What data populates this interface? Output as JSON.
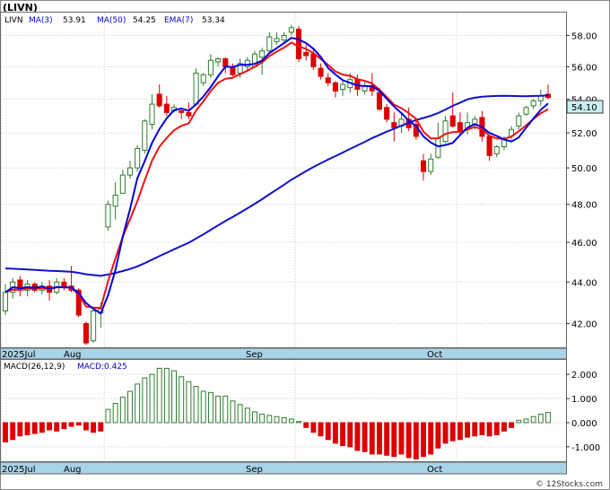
{
  "title": "(LIVN)",
  "price_panel": {
    "ticker": "LIVN",
    "indicators": [
      {
        "label": "MA(3)",
        "value": "53.91",
        "color": "#0000cc"
      },
      {
        "label": "MA(50)",
        "value": "54.25",
        "color": "#0000cc"
      },
      {
        "label": "EMA(7)",
        "value": "53.34",
        "color": "#0000cc"
      }
    ],
    "last_price": "54.10",
    "y_ticks": [
      "58.00",
      "56.00",
      "54.00",
      "52.00",
      "50.00",
      "48.00",
      "46.00",
      "44.00",
      "42.00"
    ],
    "x_labels": [
      "2025Jul",
      "Aug",
      "Sep",
      "Oct"
    ]
  },
  "macd_panel": {
    "label": "MACD(26,12,9)",
    "value_label": "MACD:0.425",
    "y_ticks": [
      "2.000",
      "1.000",
      "0.000",
      "-1.000"
    ],
    "x_labels": [
      "2025Jul",
      "Aug",
      "Sep",
      "Oct"
    ]
  },
  "footer": "© 12Stocks.com",
  "colors": {
    "up": "#2e7d2e",
    "down": "#dd0000",
    "ma_fast": "#0000dd",
    "ma_slow": "#1111cc",
    "ema": "#ee1111",
    "axis_bar": "#a9d3e8",
    "label_box": "#c8eef0"
  },
  "chart_data": [
    {
      "type": "candlestick",
      "title": "(LIVN)",
      "ylim": [
        40.9,
        59.5
      ],
      "y_scale": "log",
      "x_tick_labels": [
        "2025Jul",
        "Aug",
        "Sep",
        "Oct"
      ],
      "candles": [
        {
          "o": 42.6,
          "h": 43.9,
          "l": 42.4,
          "c": 43.5
        },
        {
          "o": 43.5,
          "h": 44.2,
          "l": 43.2,
          "c": 44.0
        },
        {
          "o": 44.1,
          "h": 44.3,
          "l": 43.3,
          "c": 43.6
        },
        {
          "o": 43.6,
          "h": 44.1,
          "l": 43.3,
          "c": 43.9
        },
        {
          "o": 43.9,
          "h": 44.0,
          "l": 43.5,
          "c": 43.6
        },
        {
          "o": 43.6,
          "h": 44.0,
          "l": 43.4,
          "c": 43.8
        },
        {
          "o": 43.8,
          "h": 44.1,
          "l": 43.1,
          "c": 43.5
        },
        {
          "o": 43.5,
          "h": 44.2,
          "l": 43.4,
          "c": 44.0
        },
        {
          "o": 44.0,
          "h": 44.2,
          "l": 43.6,
          "c": 43.8
        },
        {
          "o": 43.8,
          "h": 44.8,
          "l": 43.5,
          "c": 43.6
        },
        {
          "o": 43.6,
          "h": 43.7,
          "l": 42.3,
          "c": 42.4
        },
        {
          "o": 42.0,
          "h": 42.1,
          "l": 41.0,
          "c": 41.1
        },
        {
          "o": 41.2,
          "h": 42.8,
          "l": 41.1,
          "c": 42.6
        },
        {
          "o": 42.5,
          "h": 43.0,
          "l": 41.8,
          "c": 42.7
        },
        {
          "o": 46.8,
          "h": 48.2,
          "l": 46.6,
          "c": 48.0
        },
        {
          "o": 47.9,
          "h": 49.2,
          "l": 47.2,
          "c": 48.5
        },
        {
          "o": 48.6,
          "h": 49.9,
          "l": 48.6,
          "c": 49.6
        },
        {
          "o": 49.6,
          "h": 50.4,
          "l": 49.4,
          "c": 50.0
        },
        {
          "o": 50.0,
          "h": 51.3,
          "l": 49.8,
          "c": 51.1
        },
        {
          "o": 51.0,
          "h": 52.8,
          "l": 50.8,
          "c": 52.7
        },
        {
          "o": 52.5,
          "h": 54.3,
          "l": 52.2,
          "c": 53.7
        },
        {
          "o": 54.3,
          "h": 54.9,
          "l": 53.5,
          "c": 53.6
        },
        {
          "o": 53.7,
          "h": 54.2,
          "l": 53.0,
          "c": 53.2
        },
        {
          "o": 53.3,
          "h": 53.7,
          "l": 53.2,
          "c": 53.5
        },
        {
          "o": 53.3,
          "h": 53.5,
          "l": 52.8,
          "c": 53.2
        },
        {
          "o": 53.2,
          "h": 53.8,
          "l": 52.8,
          "c": 53.0
        },
        {
          "o": 53.7,
          "h": 55.9,
          "l": 53.6,
          "c": 55.6
        },
        {
          "o": 55.0,
          "h": 55.6,
          "l": 54.8,
          "c": 55.5
        },
        {
          "o": 55.5,
          "h": 56.8,
          "l": 55.3,
          "c": 56.4
        },
        {
          "o": 56.3,
          "h": 56.6,
          "l": 56.0,
          "c": 56.5
        },
        {
          "o": 56.5,
          "h": 56.6,
          "l": 55.6,
          "c": 56.0
        },
        {
          "o": 56.0,
          "h": 56.2,
          "l": 55.4,
          "c": 55.5
        },
        {
          "o": 55.6,
          "h": 56.5,
          "l": 55.3,
          "c": 56.2
        },
        {
          "o": 56.0,
          "h": 56.6,
          "l": 55.8,
          "c": 56.4
        },
        {
          "o": 56.0,
          "h": 57.0,
          "l": 55.9,
          "c": 56.8
        },
        {
          "o": 56.6,
          "h": 57.2,
          "l": 55.5,
          "c": 57.0
        },
        {
          "o": 57.0,
          "h": 58.2,
          "l": 56.8,
          "c": 57.9
        },
        {
          "o": 57.6,
          "h": 58.2,
          "l": 57.4,
          "c": 57.8
        },
        {
          "o": 57.7,
          "h": 58.2,
          "l": 57.5,
          "c": 58.0
        },
        {
          "o": 58.2,
          "h": 58.7,
          "l": 58.0,
          "c": 58.5
        },
        {
          "o": 58.4,
          "h": 58.6,
          "l": 56.3,
          "c": 56.5
        },
        {
          "o": 56.9,
          "h": 57.4,
          "l": 56.4,
          "c": 56.7
        },
        {
          "o": 56.8,
          "h": 57.2,
          "l": 55.8,
          "c": 56.0
        },
        {
          "o": 55.9,
          "h": 56.2,
          "l": 55.2,
          "c": 55.4
        },
        {
          "o": 55.3,
          "h": 55.6,
          "l": 54.8,
          "c": 55.0
        },
        {
          "o": 55.0,
          "h": 55.1,
          "l": 54.1,
          "c": 54.5
        },
        {
          "o": 54.6,
          "h": 55.2,
          "l": 54.2,
          "c": 54.9
        },
        {
          "o": 54.7,
          "h": 55.6,
          "l": 54.4,
          "c": 55.2
        },
        {
          "o": 55.2,
          "h": 55.5,
          "l": 54.2,
          "c": 54.6
        },
        {
          "o": 54.5,
          "h": 55.1,
          "l": 54.3,
          "c": 54.8
        },
        {
          "o": 54.8,
          "h": 55.6,
          "l": 54.2,
          "c": 54.5
        },
        {
          "o": 54.4,
          "h": 54.7,
          "l": 53.3,
          "c": 53.4
        },
        {
          "o": 53.5,
          "h": 53.7,
          "l": 52.6,
          "c": 52.8
        },
        {
          "o": 52.6,
          "h": 53.2,
          "l": 51.5,
          "c": 52.3
        },
        {
          "o": 52.4,
          "h": 53.1,
          "l": 52.0,
          "c": 52.8
        },
        {
          "o": 52.8,
          "h": 53.5,
          "l": 52.1,
          "c": 52.3
        },
        {
          "o": 52.5,
          "h": 52.8,
          "l": 51.6,
          "c": 51.8
        },
        {
          "o": 50.4,
          "h": 50.8,
          "l": 49.3,
          "c": 49.8
        },
        {
          "o": 49.8,
          "h": 50.8,
          "l": 49.6,
          "c": 50.5
        },
        {
          "o": 50.6,
          "h": 52.6,
          "l": 50.5,
          "c": 51.7
        },
        {
          "o": 51.5,
          "h": 53.0,
          "l": 51.4,
          "c": 52.7
        },
        {
          "o": 53.0,
          "h": 54.4,
          "l": 52.3,
          "c": 52.4
        },
        {
          "o": 52.6,
          "h": 53.2,
          "l": 51.8,
          "c": 52.1
        },
        {
          "o": 52.2,
          "h": 53.2,
          "l": 51.9,
          "c": 52.6
        },
        {
          "o": 52.5,
          "h": 53.0,
          "l": 52.2,
          "c": 52.8
        },
        {
          "o": 52.9,
          "h": 53.3,
          "l": 51.5,
          "c": 51.8
        },
        {
          "o": 51.8,
          "h": 51.9,
          "l": 50.4,
          "c": 50.7
        },
        {
          "o": 50.8,
          "h": 51.3,
          "l": 50.6,
          "c": 51.2
        },
        {
          "o": 51.2,
          "h": 51.8,
          "l": 51.0,
          "c": 51.6
        },
        {
          "o": 51.8,
          "h": 52.4,
          "l": 51.6,
          "c": 52.2
        },
        {
          "o": 52.4,
          "h": 53.2,
          "l": 52.2,
          "c": 53.0
        },
        {
          "o": 53.1,
          "h": 53.6,
          "l": 53.0,
          "c": 53.5
        },
        {
          "o": 53.6,
          "h": 54.0,
          "l": 53.4,
          "c": 53.9
        },
        {
          "o": 53.9,
          "h": 54.6,
          "l": 53.6,
          "c": 54.2
        },
        {
          "o": 54.3,
          "h": 54.9,
          "l": 54.0,
          "c": 54.1
        }
      ]
    },
    {
      "type": "bar",
      "title": "MACD(26,12,9)",
      "ylim": [
        -1.6,
        2.6
      ],
      "values": [
        -0.8,
        -0.7,
        -0.55,
        -0.5,
        -0.45,
        -0.4,
        -0.3,
        -0.35,
        -0.25,
        -0.15,
        -0.1,
        -0.3,
        -0.4,
        -0.35,
        0.55,
        0.8,
        1.05,
        1.3,
        1.6,
        1.85,
        2.0,
        2.25,
        2.25,
        2.15,
        1.9,
        1.7,
        1.5,
        1.3,
        1.25,
        1.1,
        1.1,
        0.9,
        0.75,
        0.6,
        0.45,
        0.35,
        0.3,
        0.25,
        0.2,
        0.15,
        0.05,
        -0.2,
        -0.4,
        -0.55,
        -0.7,
        -0.85,
        -0.95,
        -1.0,
        -1.15,
        -1.2,
        -1.3,
        -1.3,
        -1.35,
        -1.4,
        -1.3,
        -1.45,
        -1.5,
        -1.4,
        -1.3,
        -1.05,
        -0.85,
        -0.75,
        -0.7,
        -0.6,
        -0.55,
        -0.5,
        -0.55,
        -0.5,
        -0.35,
        -0.2,
        0.1,
        0.15,
        0.25,
        0.35,
        0.42
      ]
    }
  ]
}
